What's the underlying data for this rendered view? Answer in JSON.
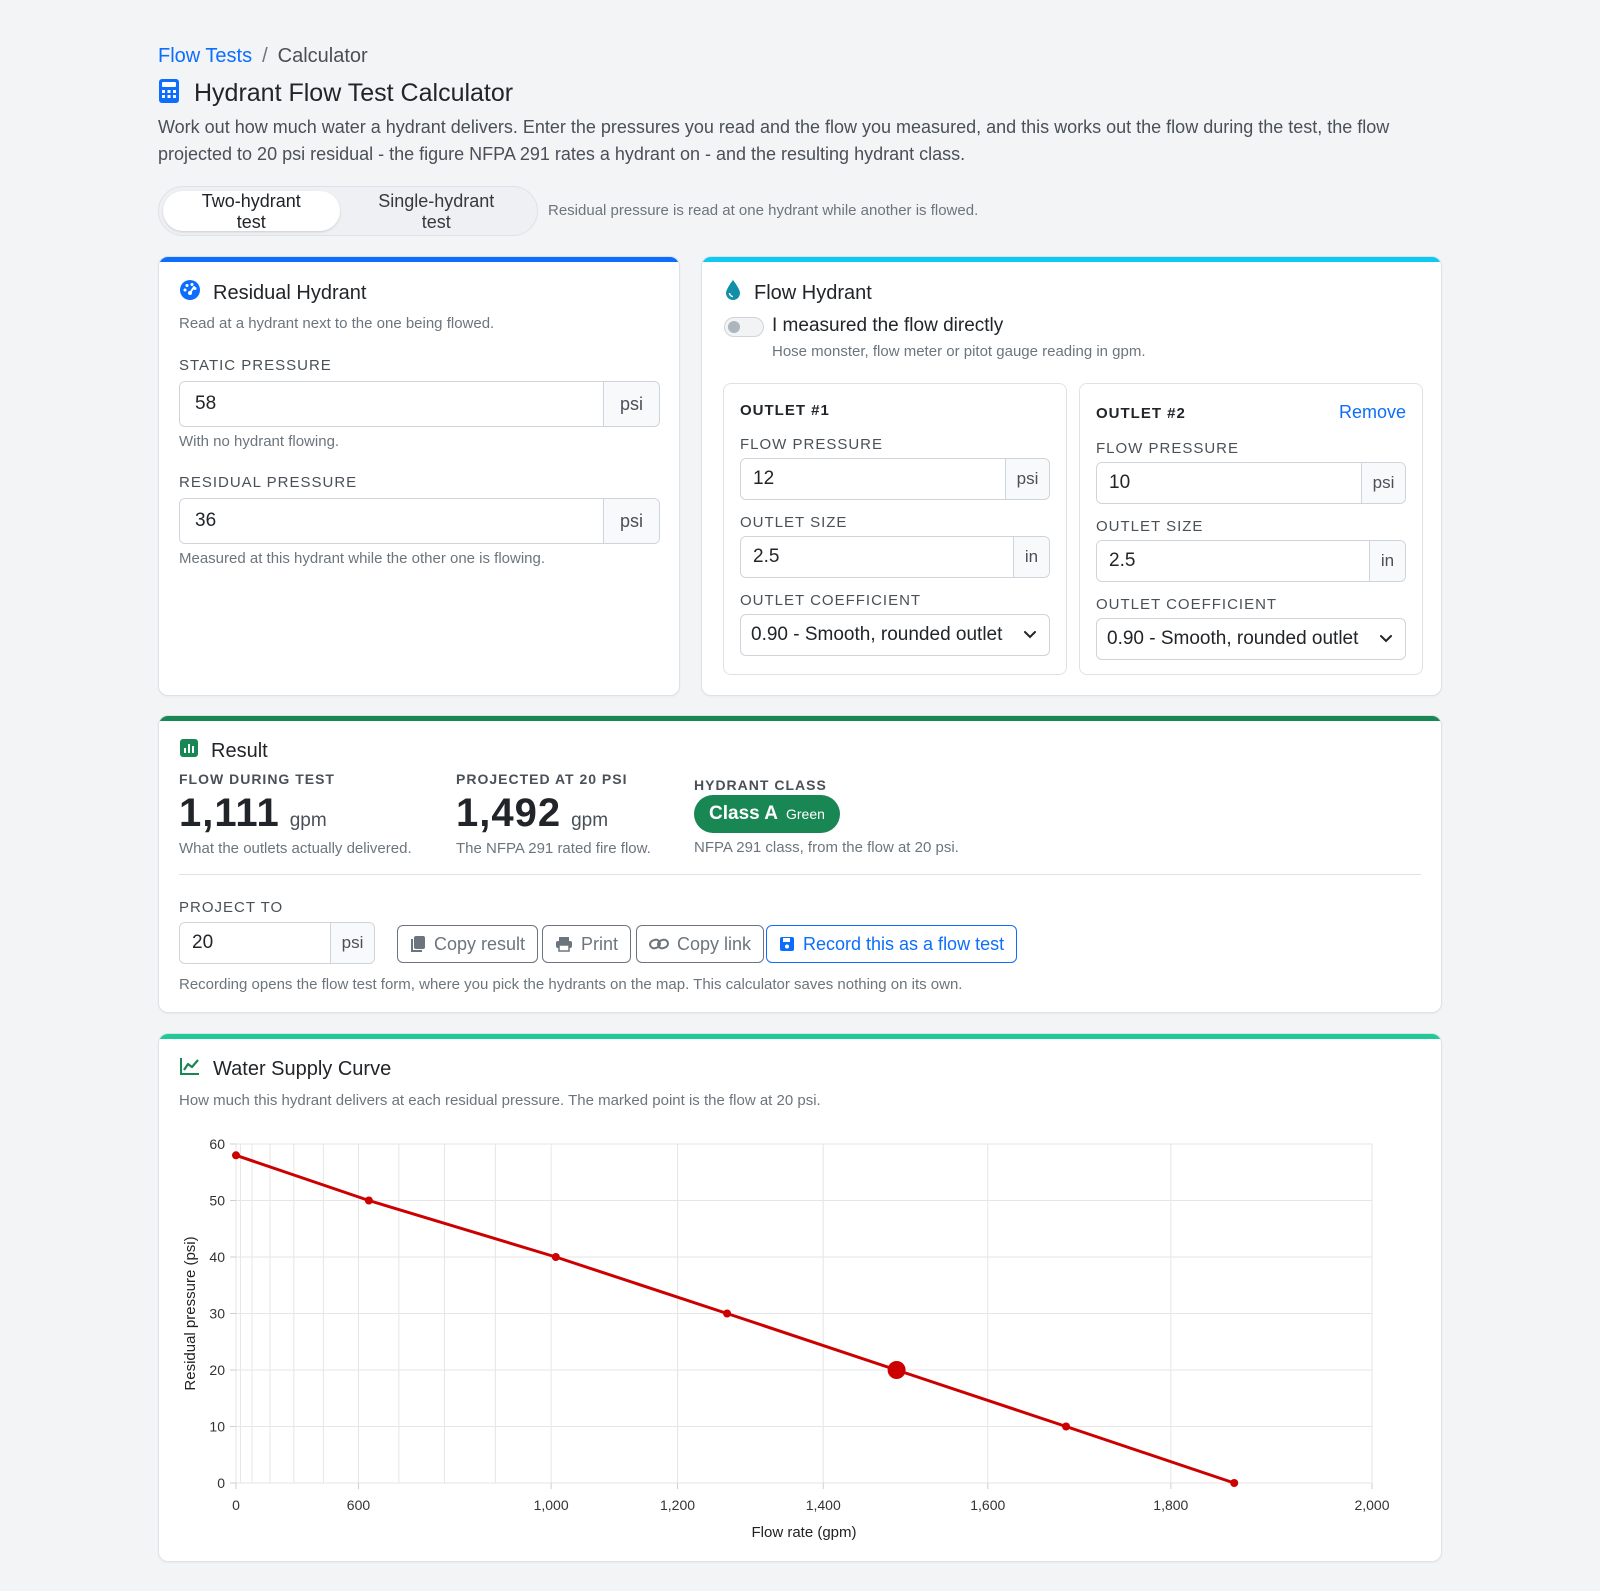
{
  "breadcrumb": {
    "parent": "Flow Tests",
    "current": "Calculator"
  },
  "header": {
    "title": "Hydrant Flow Test Calculator",
    "intro": "Work out how much water a hydrant delivers. Enter the pressures you read and the flow you measured, and this works out the flow during the test, the flow projected to 20 psi residual - the figure NFPA 291 rates a hydrant on - and the resulting hydrant class."
  },
  "mode": {
    "options": [
      "Two-hydrant test",
      "Single-hydrant test"
    ],
    "selected": "Two-hydrant test",
    "note": "Residual pressure is read at one hydrant while another is flowed."
  },
  "residual": {
    "title": "Residual Hydrant",
    "subtitle": "Read at a hydrant next to the one being flowed.",
    "static_label": "STATIC PRESSURE",
    "static_value": "58",
    "static_unit": "psi",
    "static_help": "With no hydrant flowing.",
    "residual_label": "RESIDUAL PRESSURE",
    "residual_value": "36",
    "residual_unit": "psi",
    "residual_help": "Measured at this hydrant while the other one is flowing."
  },
  "flow": {
    "title": "Flow Hydrant",
    "toggle_label": "I measured the flow directly",
    "toggle_help": "Hose monster, flow meter or pitot gauge reading in gpm.",
    "toggle_on": false,
    "outlets": [
      {
        "heading": "OUTLET #1",
        "pressure_label": "FLOW PRESSURE",
        "pressure_value": "12",
        "pressure_unit": "psi",
        "size_label": "OUTLET SIZE",
        "size_value": "2.5",
        "size_unit": "in",
        "coef_label": "OUTLET COEFFICIENT",
        "coef_value": "0.90 - Smooth, rounded outlet"
      },
      {
        "heading": "OUTLET #2",
        "remove_label": "Remove",
        "pressure_label": "FLOW PRESSURE",
        "pressure_value": "10",
        "pressure_unit": "psi",
        "size_label": "OUTLET SIZE",
        "size_value": "2.5",
        "size_unit": "in",
        "coef_label": "OUTLET COEFFICIENT",
        "coef_value": "0.90 - Smooth, rounded outlet"
      }
    ]
  },
  "result": {
    "title": "Result",
    "during_label": "FLOW DURING TEST",
    "during_value": "1,111",
    "during_unit": "gpm",
    "during_help": "What the outlets actually delivered.",
    "projected_label": "PROJECTED AT 20 PSI",
    "projected_value": "1,492",
    "projected_unit": "gpm",
    "projected_help": "The NFPA 291 rated fire flow.",
    "class_label": "HYDRANT CLASS",
    "class_value": "Class A",
    "class_color_name": "Green",
    "class_help": "NFPA 291 class, from the flow at 20 psi.",
    "project_to_label": "PROJECT TO",
    "project_to_value": "20",
    "project_to_unit": "psi",
    "buttons": {
      "copy_result": "Copy result",
      "print": "Print",
      "copy_link": "Copy link",
      "record": "Record this as a flow test"
    },
    "note": "Recording opens the flow test form, where you pick the hydrants on the map. This calculator saves nothing on its own."
  },
  "curve": {
    "title": "Water Supply Curve",
    "subtitle": "How much this hydrant delivers at each residual pressure. The marked point is the flow at 20 psi."
  },
  "colors": {
    "residual_bar": "#0d6efd",
    "flow_bar": "#0dcaf0",
    "result_bar": "#198754",
    "curve_bar": "#20c997",
    "series": "#cc0000",
    "class_badge": "#198754"
  },
  "icons": {
    "header": "calculator-icon",
    "residual": "gauge-icon",
    "flow": "droplet-icon",
    "result": "bar-chart-icon",
    "curve": "line-chart-icon"
  },
  "chart_data": {
    "type": "line",
    "xlabel": "Flow rate (gpm)",
    "ylabel": "Residual pressure (psi)",
    "x_axis_scale": "Q^1.85 (tick labels in gpm)",
    "x_ticks": [
      0,
      600,
      1000,
      1200,
      1400,
      1600,
      1800,
      2000
    ],
    "x_tick_labels": [
      "0",
      "600",
      "1,000",
      "1,200",
      "1,400",
      "1,600",
      "1,800",
      "2,000"
    ],
    "y_ticks": [
      0,
      10,
      20,
      30,
      40,
      50,
      60
    ],
    "y_tick_labels": [
      "0",
      "10",
      "20",
      "30",
      "40",
      "50",
      "60"
    ],
    "xlim": [
      0,
      2000
    ],
    "ylim": [
      0,
      60
    ],
    "grid": true,
    "series": [
      {
        "points": [
          [
            0,
            58
          ],
          [
            627,
            50
          ],
          [
            1008,
            40
          ],
          [
            1271,
            30
          ],
          [
            1492,
            20
          ],
          [
            1688,
            10
          ],
          [
            1865,
            0
          ]
        ],
        "highlight": [
          1492,
          20
        ]
      }
    ]
  }
}
